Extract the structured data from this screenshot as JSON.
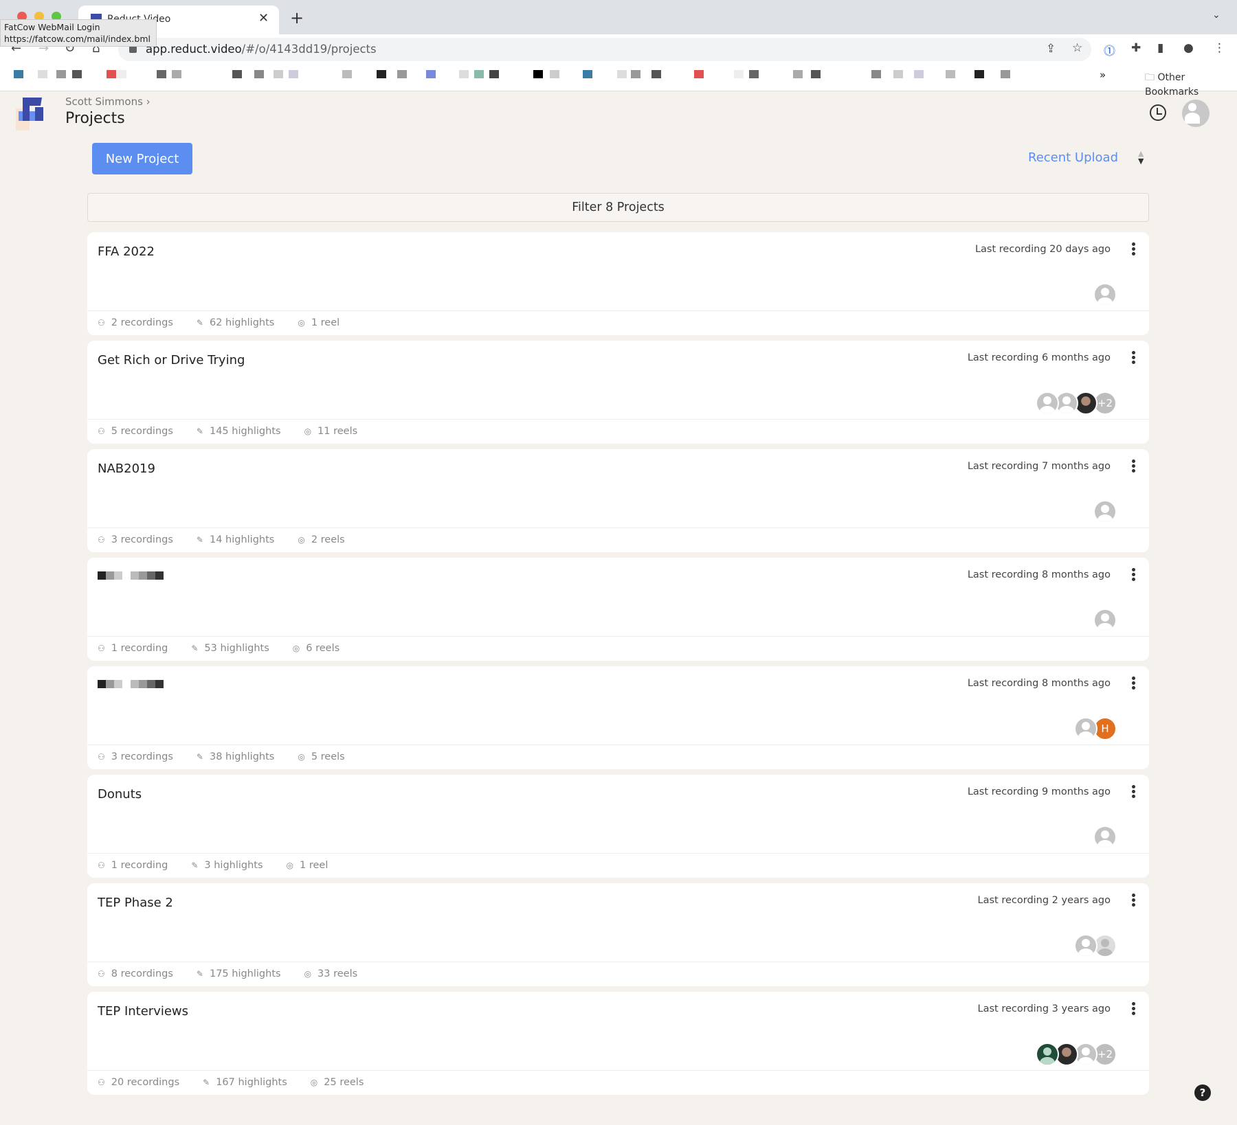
{
  "browser": {
    "tab_title": "Reduct Video",
    "url_host": "app.reduct.video",
    "url_path": "/#/o/4143dd19/projects",
    "tooltip_title": "FatCow WebMail Login",
    "tooltip_url": "https://fatcow.com/mail/index.bml",
    "other_bookmarks": "Other Bookmarks",
    "more_bookmarks": "»"
  },
  "header": {
    "breadcrumb": "Scott Simmons",
    "breadcrumb_sep": "›",
    "title": "Projects"
  },
  "toolbar": {
    "new_project": "New Project",
    "sort_label": "Recent Upload",
    "sort_arrows": "▲▼"
  },
  "filter": {
    "placeholder": "Filter 8 Projects"
  },
  "colors": {
    "accent": "#5b8ef0",
    "background": "#f5f2ee",
    "avatar_letter": "#e07020"
  },
  "help": "?",
  "projects": [
    {
      "title": "FFA 2022",
      "last": "Last recording 20 days ago",
      "recordings": "2 recordings",
      "highlights": "62 highlights",
      "reels": "1 reel",
      "avatars": [
        {
          "type": "default"
        }
      ]
    },
    {
      "title": "Get Rich or Drive Trying",
      "last": "Last recording 6 months ago",
      "recordings": "5 recordings",
      "highlights": "145 highlights",
      "reels": "11 reels",
      "avatars": [
        {
          "type": "default"
        },
        {
          "type": "default"
        },
        {
          "type": "photo"
        },
        {
          "type": "plus",
          "label": "+2"
        }
      ]
    },
    {
      "title": "NAB2019",
      "last": "Last recording 7 months ago",
      "recordings": "3 recordings",
      "highlights": "14 highlights",
      "reels": "2 reels",
      "avatars": [
        {
          "type": "default"
        }
      ]
    },
    {
      "title": "",
      "redacted": true,
      "last": "Last recording 8 months ago",
      "recordings": "1 recording",
      "highlights": "53 highlights",
      "reels": "6 reels",
      "avatars": [
        {
          "type": "default"
        }
      ]
    },
    {
      "title": "",
      "redacted": true,
      "last": "Last recording 8 months ago",
      "recordings": "3 recordings",
      "highlights": "38 highlights",
      "reels": "5 reels",
      "avatars": [
        {
          "type": "default"
        },
        {
          "type": "letter",
          "label": "H"
        }
      ]
    },
    {
      "title": "Donuts",
      "last": "Last recording 9 months ago",
      "recordings": "1 recording",
      "highlights": "3 highlights",
      "reels": "1 reel",
      "avatars": [
        {
          "type": "default"
        }
      ]
    },
    {
      "title": "TEP Phase 2",
      "last": "Last recording 2 years ago",
      "recordings": "8 recordings",
      "highlights": "175 highlights",
      "reels": "33 reels",
      "avatars": [
        {
          "type": "default"
        },
        {
          "type": "disabled"
        }
      ]
    },
    {
      "title": "TEP Interviews",
      "last": "Last recording 3 years ago",
      "recordings": "20 recordings",
      "highlights": "167 highlights",
      "reels": "25 reels",
      "avatars": [
        {
          "type": "green"
        },
        {
          "type": "photo"
        },
        {
          "type": "default"
        },
        {
          "type": "plus",
          "label": "+2"
        }
      ]
    }
  ]
}
